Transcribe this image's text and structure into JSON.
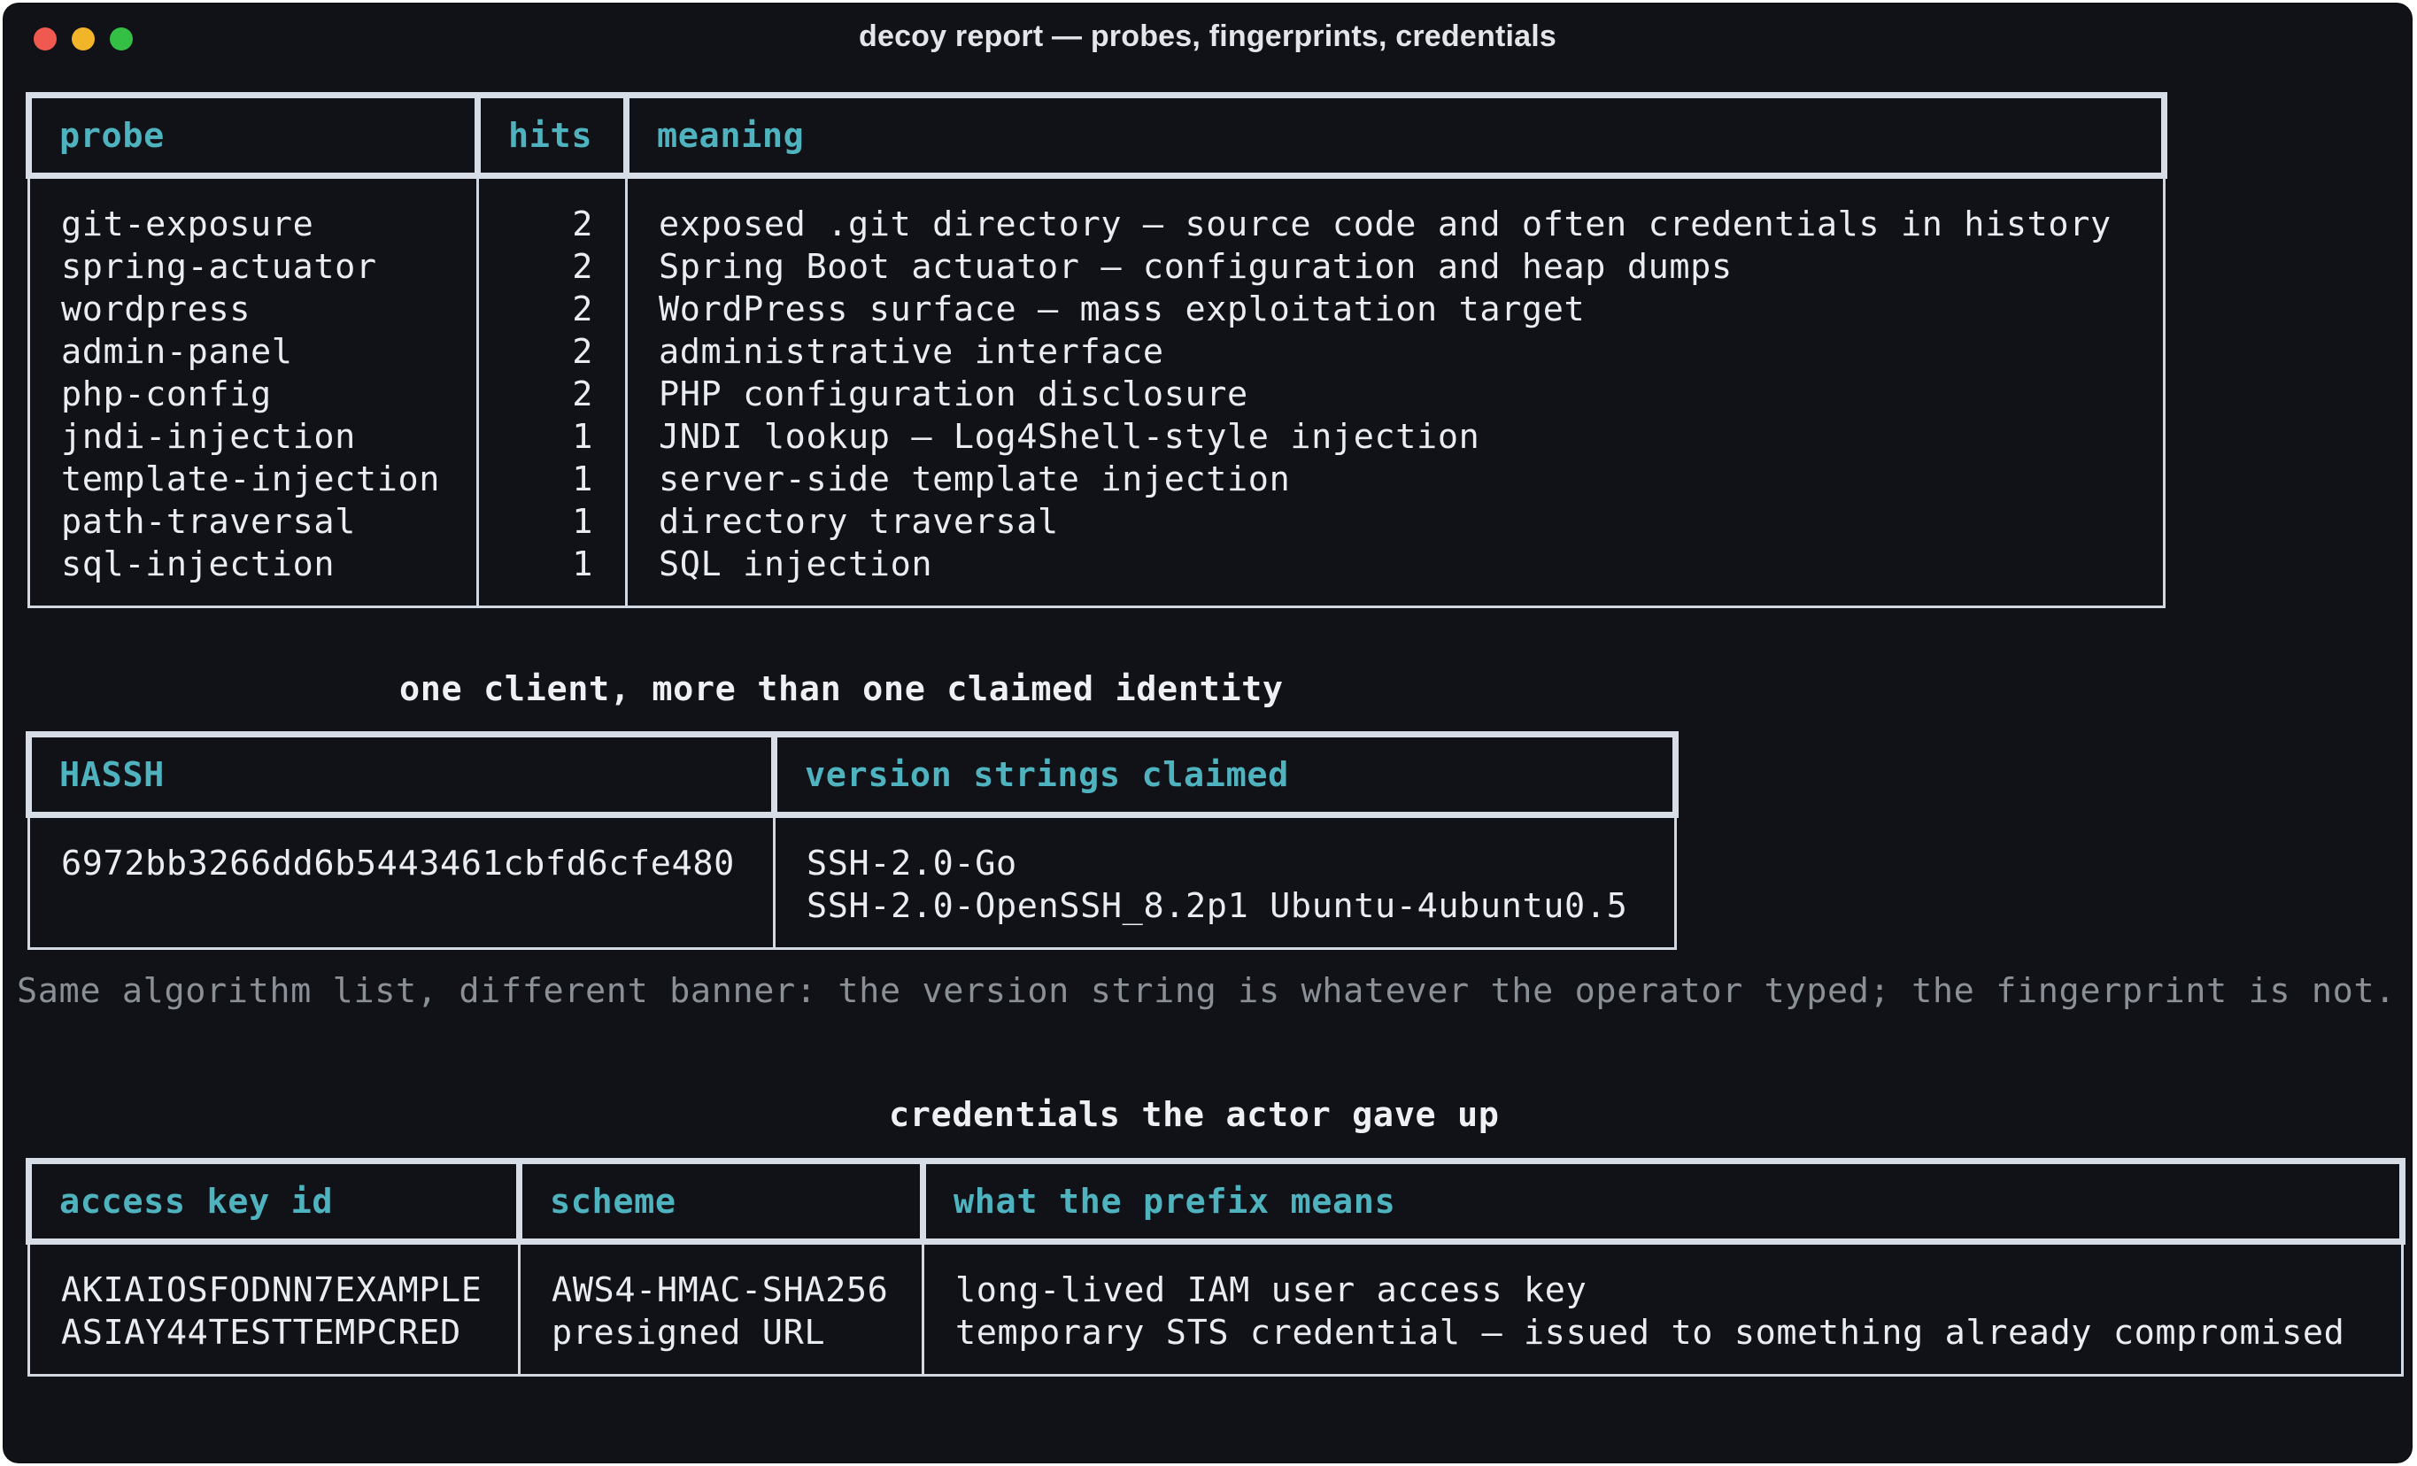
{
  "window": {
    "title": "decoy report — probes, fingerprints, credentials"
  },
  "probes": {
    "headers": [
      "probe",
      "hits",
      "meaning"
    ],
    "rows": [
      {
        "probe": "git-exposure",
        "hits": "2",
        "meaning": "exposed .git directory — source code and often credentials in history"
      },
      {
        "probe": "spring-actuator",
        "hits": "2",
        "meaning": "Spring Boot actuator — configuration and heap dumps"
      },
      {
        "probe": "wordpress",
        "hits": "2",
        "meaning": "WordPress surface — mass exploitation target"
      },
      {
        "probe": "admin-panel",
        "hits": "2",
        "meaning": "administrative interface"
      },
      {
        "probe": "php-config",
        "hits": "2",
        "meaning": "PHP configuration disclosure"
      },
      {
        "probe": "jndi-injection",
        "hits": "1",
        "meaning": "JNDI lookup — Log4Shell-style injection"
      },
      {
        "probe": "template-injection",
        "hits": "1",
        "meaning": "server-side template injection"
      },
      {
        "probe": "path-traversal",
        "hits": "1",
        "meaning": "directory traversal"
      },
      {
        "probe": "sql-injection",
        "hits": "1",
        "meaning": "SQL injection"
      }
    ]
  },
  "identity": {
    "heading": "one client, more than one claimed identity",
    "headers": [
      "HASSH",
      "version strings claimed"
    ],
    "hassh": "6972bb3266dd6b5443461cbfd6cfe480",
    "versions": [
      "SSH-2.0-Go",
      "SSH-2.0-OpenSSH_8.2p1 Ubuntu-4ubuntu0.5"
    ],
    "note": "Same algorithm list, different banner: the version string is whatever the operator typed; the fingerprint is not."
  },
  "credentials": {
    "heading": "credentials the actor gave up",
    "headers": [
      "access key id",
      "scheme",
      "what the prefix means"
    ],
    "key_ids": [
      "AKIAIOSFODNN7EXAMPLE",
      "ASIAY44TESTTEMPCRED"
    ],
    "schemes": [
      "AWS4-HMAC-SHA256",
      "presigned URL"
    ],
    "meanings": [
      "long-lived IAM user access key",
      "temporary STS credential — issued to something already compromised"
    ]
  },
  "colors": {
    "background": "#101217",
    "header_text": "#4fb3bf",
    "body_text": "#e9ecf0",
    "muted_text": "#8b8f96",
    "border": "#d7dde7"
  }
}
